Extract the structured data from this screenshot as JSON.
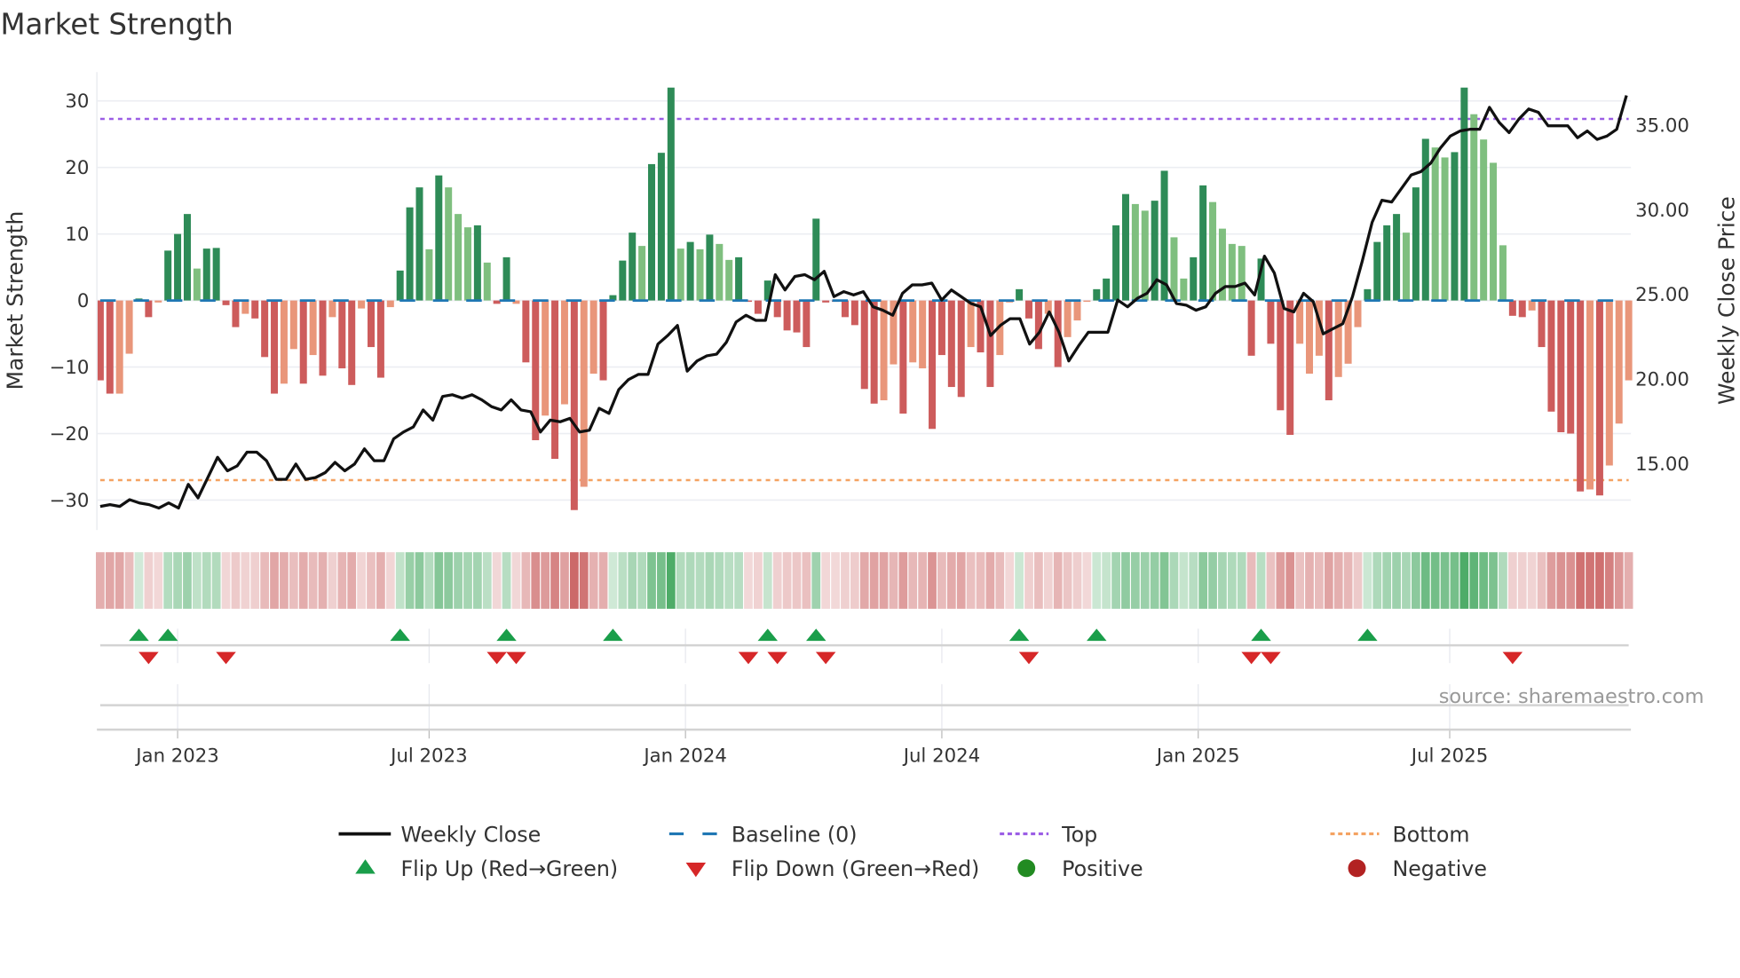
{
  "chart_data": {
    "type": "bar",
    "title": "Market Strength",
    "ylabel": "Market Strength",
    "ylabel_right": "Weekly Close Price",
    "source": "source: sharemaestro.com",
    "ylim": [
      -33,
      33
    ],
    "ylim_right": [
      11.5,
      37.5
    ],
    "yticks": [
      30,
      20,
      10,
      0,
      -10,
      -20,
      -30
    ],
    "ytick_labels": [
      "30",
      "20",
      "10",
      "0",
      "−10",
      "−20",
      "−30"
    ],
    "yticks_right": [
      35,
      30,
      25,
      20,
      15
    ],
    "ytick_labels_right": [
      "35.00",
      "30.00",
      "25.00",
      "20.00",
      "15.00"
    ],
    "x_start": "2022-11-06",
    "x_frequency": "weekly",
    "xtick_labels": [
      "Jan 2023",
      "Jul 2023",
      "Jan 2024",
      "Jul 2024",
      "Jan 2025",
      "Jul 2025"
    ],
    "xtick_week_index": [
      8,
      34,
      60.5,
      87,
      113.5,
      139.5
    ],
    "top_level": 27.3,
    "bottom_level": -27,
    "baseline": 0,
    "grid": true,
    "values": [
      -12,
      -14,
      -14,
      -8,
      0.3,
      -2.5,
      -0.3,
      7.5,
      10,
      13,
      4.8,
      7.8,
      7.9,
      -0.7,
      -4,
      -2,
      -2.7,
      -8.5,
      -14,
      -12.5,
      -7.3,
      -12.5,
      -8.2,
      -11.3,
      -2.5,
      -10.2,
      -12.7,
      -1.2,
      -7,
      -11.6,
      -1,
      4.5,
      14,
      17,
      7.7,
      18.8,
      17,
      13,
      11,
      11.3,
      5.7,
      -0.5,
      6.5,
      -0.5,
      -9.3,
      -21,
      -17.3,
      -23.8,
      -15.6,
      -31.5,
      -28,
      -11,
      -12,
      0.8,
      6,
      10.2,
      8.2,
      20.5,
      22.2,
      32,
      7.8,
      8.8,
      7.7,
      9.9,
      8.5,
      6.1,
      6.5,
      -0.2,
      -2,
      3,
      -2.5,
      -4.5,
      -4.8,
      -7,
      12.3,
      -0.3,
      -0.2,
      -2.5,
      -3.7,
      -13.3,
      -15.5,
      -15,
      -9.6,
      -17,
      -9.3,
      -10.2,
      -19.3,
      -8.2,
      -13,
      -14.5,
      -7,
      -7.8,
      -13,
      -8.2,
      -0.3,
      1.7,
      -2.7,
      -7.3,
      -2,
      -10,
      -5.5,
      -3,
      -0.2,
      1.7,
      3.3,
      11.3,
      16,
      14.5,
      13.5,
      15,
      19.5,
      9.5,
      3.3,
      6.5,
      17.3,
      14.8,
      10.8,
      8.5,
      8.2,
      -8.3,
      6.3,
      -6.5,
      -16.5,
      -20.2,
      -6.5,
      -11,
      -8.3,
      -15,
      -11.5,
      -9.5,
      -4,
      1.7,
      8.8,
      11.3,
      13,
      10.2,
      17,
      24.3,
      23,
      21.5,
      22.3,
      32,
      28,
      24.2,
      20.7,
      8.3,
      -2.3,
      -2.5,
      -1.5,
      -7,
      -16.7,
      -19.8,
      -20,
      -28.7,
      -28.4,
      -29.3,
      -24.8,
      -18.5,
      -12
    ],
    "bar_styles": "RRrrGRrGGGgGGRRrRRRrrRrRrRRrRRrGGGgGgggGgRGrRRrRrRrrRGGGgGGGgGgGggGRRGRRRRGRRRRRRrrRrrRRRRrRRrrGRRrRrrrGGGGggGGggGGggggRGRRRrrrRrrrGGGGgGGggGGggggRRrRRRRRrRrrr",
    "bar_style_key": {
      "G": "positive rising",
      "g": "positive falling",
      "R": "negative falling",
      "r": "negative rising"
    },
    "colors": {
      "G": "#2e8b57",
      "g": "#7fbf7f",
      "R": "#cd5c5c",
      "r": "#e9967a",
      "line": "#111111",
      "baseline": "#1f77b4",
      "top": "#9b5de5",
      "bottom": "#f4a261",
      "flip_up": "#1a9e4a",
      "flip_down": "#d62728",
      "positive": "#228b22",
      "negative": "#b22222"
    },
    "weekly_close": [
      12.4,
      12.5,
      12.4,
      12.8,
      12.6,
      12.5,
      12.3,
      12.6,
      12.3,
      13.7,
      12.9,
      14.1,
      15.3,
      14.5,
      14.8,
      15.6,
      15.6,
      15.1,
      14.0,
      14.0,
      14.9,
      14.0,
      14.1,
      14.4,
      15.0,
      14.5,
      14.9,
      15.8,
      15.1,
      15.1,
      16.4,
      16.8,
      17.1,
      18.1,
      17.5,
      18.9,
      19.0,
      18.8,
      19.0,
      18.7,
      18.3,
      18.1,
      18.7,
      18.1,
      18.0,
      16.8,
      17.5,
      17.4,
      17.6,
      16.8,
      16.9,
      18.2,
      17.9,
      19.3,
      19.9,
      20.2,
      20.2,
      22.0,
      22.5,
      23.1,
      20.4,
      21.0,
      21.3,
      21.4,
      22.1,
      23.3,
      23.7,
      23.4,
      23.4,
      26.1,
      25.2,
      26.0,
      26.1,
      25.8,
      26.3,
      24.8,
      25.1,
      24.9,
      25.1,
      24.2,
      24.0,
      23.7,
      25.0,
      25.5,
      25.5,
      25.6,
      24.6,
      25.2,
      24.8,
      24.4,
      24.2,
      22.5,
      23.1,
      23.5,
      23.5,
      22.0,
      22.7,
      23.9,
      22.7,
      21.0,
      21.9,
      22.7,
      22.7,
      22.7,
      24.6,
      24.2,
      24.7,
      25.0,
      25.8,
      25.5,
      24.4,
      24.3,
      24.0,
      24.2,
      25.0,
      25.4,
      25.4,
      25.6,
      24.9,
      27.2,
      26.2,
      24.1,
      23.9,
      25.0,
      24.5,
      22.6,
      22.9,
      23.2,
      24.8,
      26.9,
      29.2,
      30.5,
      30.4,
      31.2,
      32.0,
      32.2,
      32.7,
      33.6,
      34.3,
      34.6,
      34.7,
      34.7,
      36.0,
      35.1,
      34.5,
      35.3,
      35.9,
      35.7,
      34.9,
      34.9,
      34.9,
      34.2,
      34.6,
      34.1,
      34.3,
      34.7,
      36.7
    ],
    "flip_up_index": [
      4,
      7,
      31,
      42,
      53,
      69,
      74,
      95,
      103,
      120,
      131
    ],
    "flip_down_index": [
      5,
      13,
      41,
      43,
      67,
      70,
      75,
      96,
      119,
      121,
      146
    ],
    "legend_position": "bottom",
    "legend": [
      {
        "label": "Weekly Close",
        "kind": "line"
      },
      {
        "label": "Baseline (0)",
        "kind": "dash"
      },
      {
        "label": "Top",
        "kind": "dot-top"
      },
      {
        "label": "Bottom",
        "kind": "dot-bottom"
      },
      {
        "label": "Flip Up (Red→Green)",
        "kind": "tri-up"
      },
      {
        "label": "Flip Down (Green→Red)",
        "kind": "tri-down"
      },
      {
        "label": "Positive",
        "kind": "circle-pos"
      },
      {
        "label": "Negative",
        "kind": "circle-neg"
      }
    ]
  }
}
